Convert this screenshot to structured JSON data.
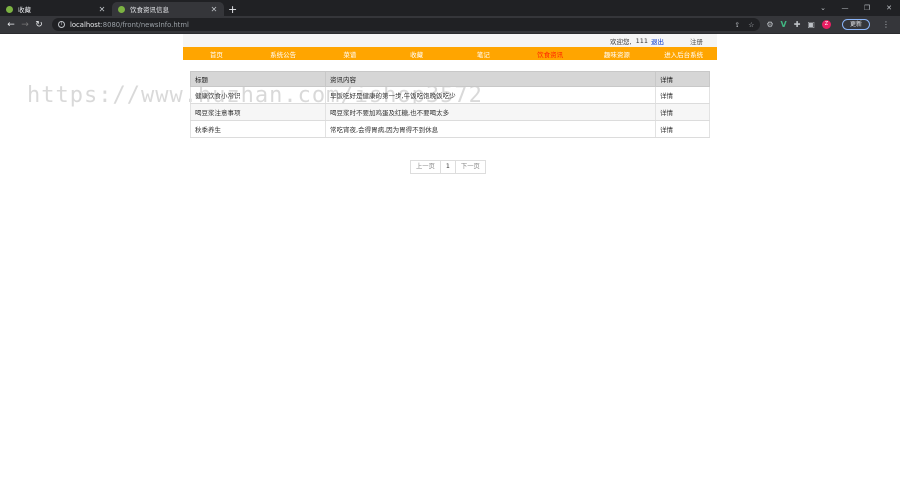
{
  "browser": {
    "tabs": [
      {
        "title": "收藏",
        "active": false
      },
      {
        "title": "饮食资讯信息",
        "active": true
      }
    ],
    "new_tab": "+",
    "url_host": "localhost",
    "url_path": ":8080/front/newsInfo.html",
    "update_label": "更新",
    "profile_initial": "Z"
  },
  "header": {
    "welcome": "欢迎您,",
    "username": "111",
    "logout": "退出",
    "register": "注册"
  },
  "nav": {
    "items": [
      "首页",
      "系统公告",
      "菜谱",
      "收藏",
      "笔记",
      "饮食资讯",
      "趣味资源",
      "进入后台系统"
    ],
    "current_index": 5
  },
  "table": {
    "headers": [
      "标题",
      "资讯内容",
      "详情"
    ],
    "rows": [
      {
        "title": "健康饮食小常识",
        "content": "早饭吃好是健康的第一步,午饭吃饱晚饭吃少",
        "detail": "详情"
      },
      {
        "title": "喝豆浆注意事项",
        "content": "喝豆浆时不要加鸡蛋及红糖,也不要喝太多",
        "detail": "详情"
      },
      {
        "title": "秋季养生",
        "content": "常吃宵夜,会得胃病,因为胃得不到休息",
        "detail": "详情"
      }
    ]
  },
  "pager": {
    "prev": "上一页",
    "current": "1",
    "next": "下一页"
  },
  "watermark": "https://www.huzhan.com/ishop3572"
}
